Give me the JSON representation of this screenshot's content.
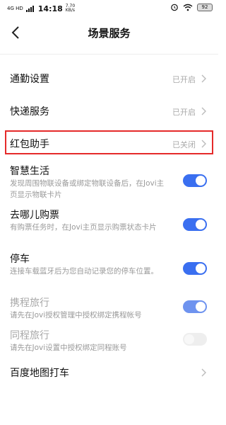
{
  "status_bar": {
    "network": "4G HD",
    "time": "14:18",
    "speed_value": "7.70",
    "speed_unit": "KB/s",
    "battery": "92"
  },
  "header": {
    "title": "场景服务"
  },
  "items": [
    {
      "title": "通勤设置",
      "status": "已开启"
    },
    {
      "title": "快递服务",
      "status": "已开启"
    },
    {
      "title": "红包助手",
      "status": "已关闭"
    },
    {
      "title": "智慧生活",
      "subtitle": "发现周围物联设备或绑定物联设备后，在Jovi主页显示物联卡片",
      "toggle": "on"
    },
    {
      "title": "去哪儿购票",
      "subtitle": "有购票任务时，在Jovi主页显示购票状态卡片",
      "toggle": "on"
    },
    {
      "title": "停车",
      "subtitle": "连接车载蓝牙后为您自动记录您的停车位置。",
      "toggle": "on"
    },
    {
      "title": "携程旅行",
      "subtitle": "请先在Jovi授权管理中授权绑定携程帐号",
      "toggle": "on-disabled"
    },
    {
      "title": "同程旅行",
      "subtitle": "请先在Jovi设置中授权绑定同程账号",
      "toggle": "off-disabled"
    },
    {
      "title": "百度地图打车"
    }
  ],
  "colors": {
    "accent": "#3a6ff0",
    "highlight_border": "#e52a2a"
  }
}
